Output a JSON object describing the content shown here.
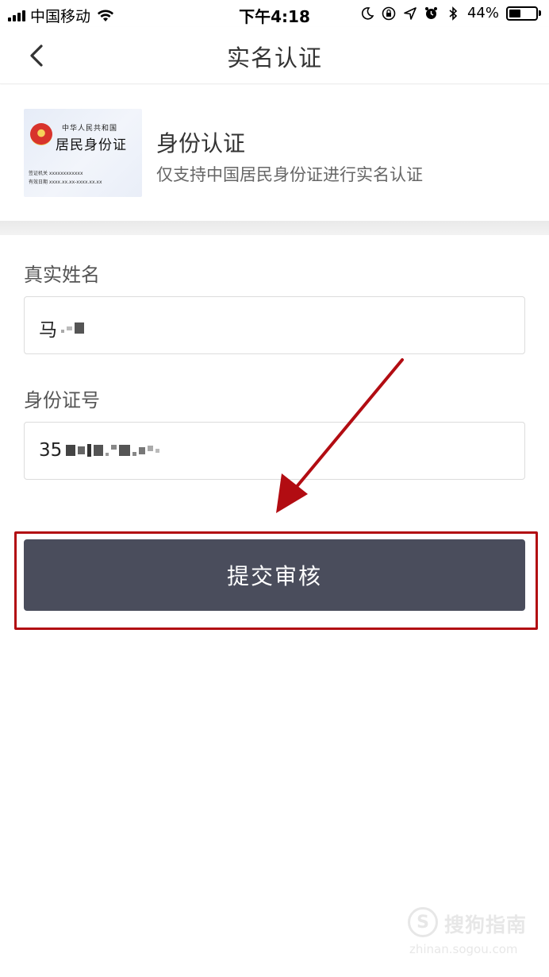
{
  "status_bar": {
    "carrier": "中国移动",
    "time": "下午4:18",
    "battery_percent": "44%",
    "battery_level": 0.44
  },
  "nav": {
    "title": "实名认证",
    "back_icon": "chevron-left-icon"
  },
  "id_info": {
    "card_header": "中华人民共和国",
    "card_title": "居民身份证",
    "card_line1": "签证机关 xxxxxxxxxxxx",
    "card_line2": "有效日期 xxxx.xx.xx-xxxx.xx.xx",
    "title": "身份认证",
    "description": "仅支持中国居民身份证进行实名认证"
  },
  "form": {
    "name_label": "真实姓名",
    "name_value": "马",
    "id_label": "身份证号",
    "id_value": "35"
  },
  "submit": {
    "label": "提交审核"
  },
  "annotation": {
    "highlight_color": "#b20c12"
  },
  "watermark": {
    "name": "搜狗指南",
    "url": "zhinan.sogou.com"
  },
  "colors": {
    "button": "#4a4d5c",
    "annotation_red": "#b20c12"
  }
}
